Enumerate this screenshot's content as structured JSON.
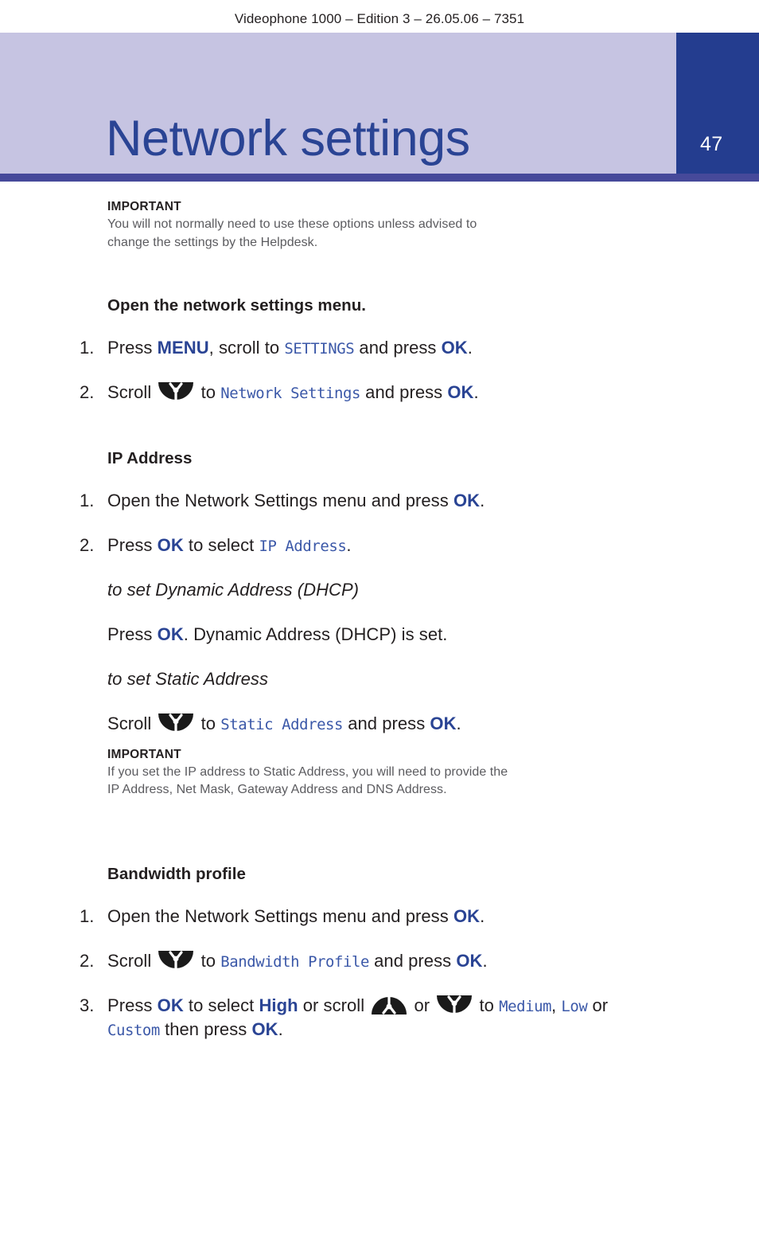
{
  "running_head": "Videophone 1000 – Edition 3 – 26.05.06 – 7351",
  "header": {
    "title": "Network settings",
    "page_number": "47",
    "band_color": "#c6c4e2",
    "tab_color": "#243d8f",
    "title_color": "#2a4494",
    "rule_color": "#46499a"
  },
  "colors": {
    "keyword_blue": "#2a4494",
    "lcd_blue": "#3b58a8",
    "body_text": "#231f20",
    "note_text": "#5b5b5f"
  },
  "notes": {
    "important_label": "IMPORTANT",
    "top_note_line1": "You will not normally need to use these options unless advised to",
    "top_note_line2": "change the settings by the Helpdesk.",
    "static_note_line1": "If you set the IP address to Static Address, you will need to provide the",
    "static_note_line2": "IP Address, Net Mask, Gateway Address and DNS Address."
  },
  "sections": {
    "open_menu": {
      "heading": "Open the network settings menu.",
      "step1": {
        "num": "1.",
        "t1": "Press ",
        "key1": "MENU",
        "t2": ", scroll to ",
        "lcd1": "SETTINGS",
        "t3": " and press ",
        "key2": "OK",
        "t4": "."
      },
      "step2": {
        "num": "2.",
        "t1": "Scroll ",
        "icon": "scroll-down-icon",
        "t2": " to ",
        "lcd1": "Network Settings",
        "t3": " and press ",
        "key1": "OK",
        "t4": "."
      }
    },
    "ip_address": {
      "heading": "IP Address",
      "step1": {
        "num": "1.",
        "t1": "Open the Network Settings menu and press ",
        "key1": "OK",
        "t2": "."
      },
      "step2": {
        "num": "2.",
        "t1": "Press ",
        "key1": "OK",
        "t2": " to select ",
        "lcd1": "IP Address",
        "t3": "."
      },
      "dhcp_label": "to set Dynamic Address (DHCP)",
      "dhcp_body": {
        "t1": "Press ",
        "key1": "OK",
        "t2": ". Dynamic Address (DHCP) is set."
      },
      "static_label": "to set Static Address",
      "static_body": {
        "t1": "Scroll ",
        "icon": "scroll-down-icon",
        "t2": " to ",
        "lcd1": "Static Address",
        "t3": " and press ",
        "key1": "OK",
        "t4": "."
      }
    },
    "bandwidth": {
      "heading": "Bandwidth profile",
      "step1": {
        "num": "1.",
        "t1": "Open the Network Settings menu and press ",
        "key1": "OK",
        "t2": "."
      },
      "step2": {
        "num": "2.",
        "t1": "Scroll ",
        "icon": "scroll-down-icon",
        "t2": " to ",
        "lcd1": "Bandwidth Profile",
        "t3": " and press ",
        "key1": "OK",
        "t4": "."
      },
      "step3": {
        "num": "3.",
        "t1": "Press ",
        "key1": "OK",
        "t2": " to select ",
        "key2": "High",
        "t3": " or scroll ",
        "icon_up": "scroll-up-icon",
        "t4": " or ",
        "icon_down": "scroll-down-icon",
        "t5": " to ",
        "lcd1": "Medium",
        "t6": ", ",
        "lcd2": "Low",
        "t7": " or ",
        "lcd3": "Custom",
        "t8": " then press ",
        "key3": "OK",
        "t9": "."
      }
    }
  }
}
